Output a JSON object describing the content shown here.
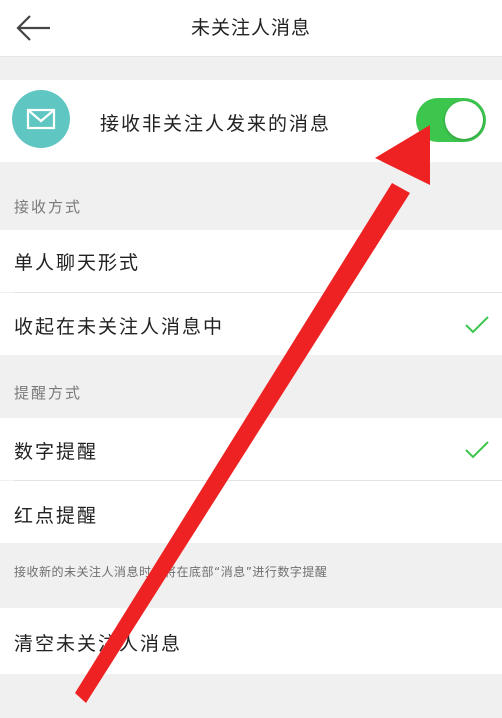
{
  "header": {
    "title": "未关注人消息",
    "back_icon": "arrow-left-icon"
  },
  "receive_toggle": {
    "label": "接收非关注人发来的消息",
    "icon": "mail-icon",
    "icon_color": "#5fc6c1",
    "enabled": true,
    "on_color": "#3dc64e"
  },
  "receive_mode": {
    "section_label": "接收方式",
    "options": [
      {
        "label": "单人聊天形式",
        "selected": false
      },
      {
        "label": "收起在未关注人消息中",
        "selected": true
      }
    ]
  },
  "reminder_mode": {
    "section_label": "提醒方式",
    "options": [
      {
        "label": "数字提醒",
        "selected": true
      },
      {
        "label": "红点提醒",
        "selected": false
      }
    ],
    "note": "接收新的未关注人消息时，将在底部“消息”进行数字提醒"
  },
  "clear": {
    "label": "清空未关注人消息"
  },
  "annotation": {
    "arrow_color": "#ee2222"
  },
  "check_color": "#3dc64e"
}
